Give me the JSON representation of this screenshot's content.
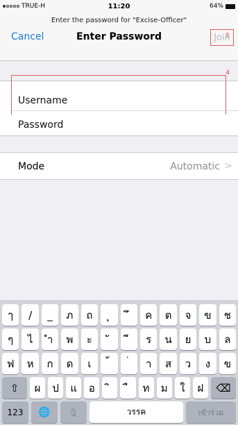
{
  "status": {
    "carrier": "TRUE-H",
    "time": "11:20",
    "battery": "64%"
  },
  "header": {
    "prompt": "Enter the password for \"Excise-Officer\"",
    "cancel_label": "Cancel",
    "title": "Enter Password",
    "join_label": "Join",
    "annotation_join": "5"
  },
  "credentials": {
    "annotation": "4",
    "username_label": "Username",
    "password_label": "Password"
  },
  "mode": {
    "label": "Mode",
    "value": "Automatic",
    "chevron": ">"
  },
  "keyboard": {
    "row1": [
      "ๅ",
      "/",
      "_",
      "ภ",
      "ถ",
      "ุ",
      "ึ",
      "ค",
      "ต",
      "จ",
      "ข",
      "ช"
    ],
    "row2": [
      "ๆ",
      "ไ",
      "ำ",
      "พ",
      "ะ",
      "ั",
      "ี",
      "ร",
      "น",
      "ย",
      "บ",
      "ล"
    ],
    "row3": [
      "ฟ",
      "ห",
      "ก",
      "ด",
      "เ",
      "้",
      "่",
      "า",
      "ส",
      "ว",
      "ง",
      "ข"
    ],
    "row4": [
      "ผ",
      "ป",
      "แ",
      "อ",
      "ิ",
      "ื",
      "ท",
      "ม",
      "ใ",
      "ฝ"
    ],
    "shift": "⇧",
    "delete": "⌫",
    "numbers": "123",
    "globe": "🌐",
    "mic": "🎙",
    "space": "วรรค",
    "go": "เข้าร่วม"
  }
}
